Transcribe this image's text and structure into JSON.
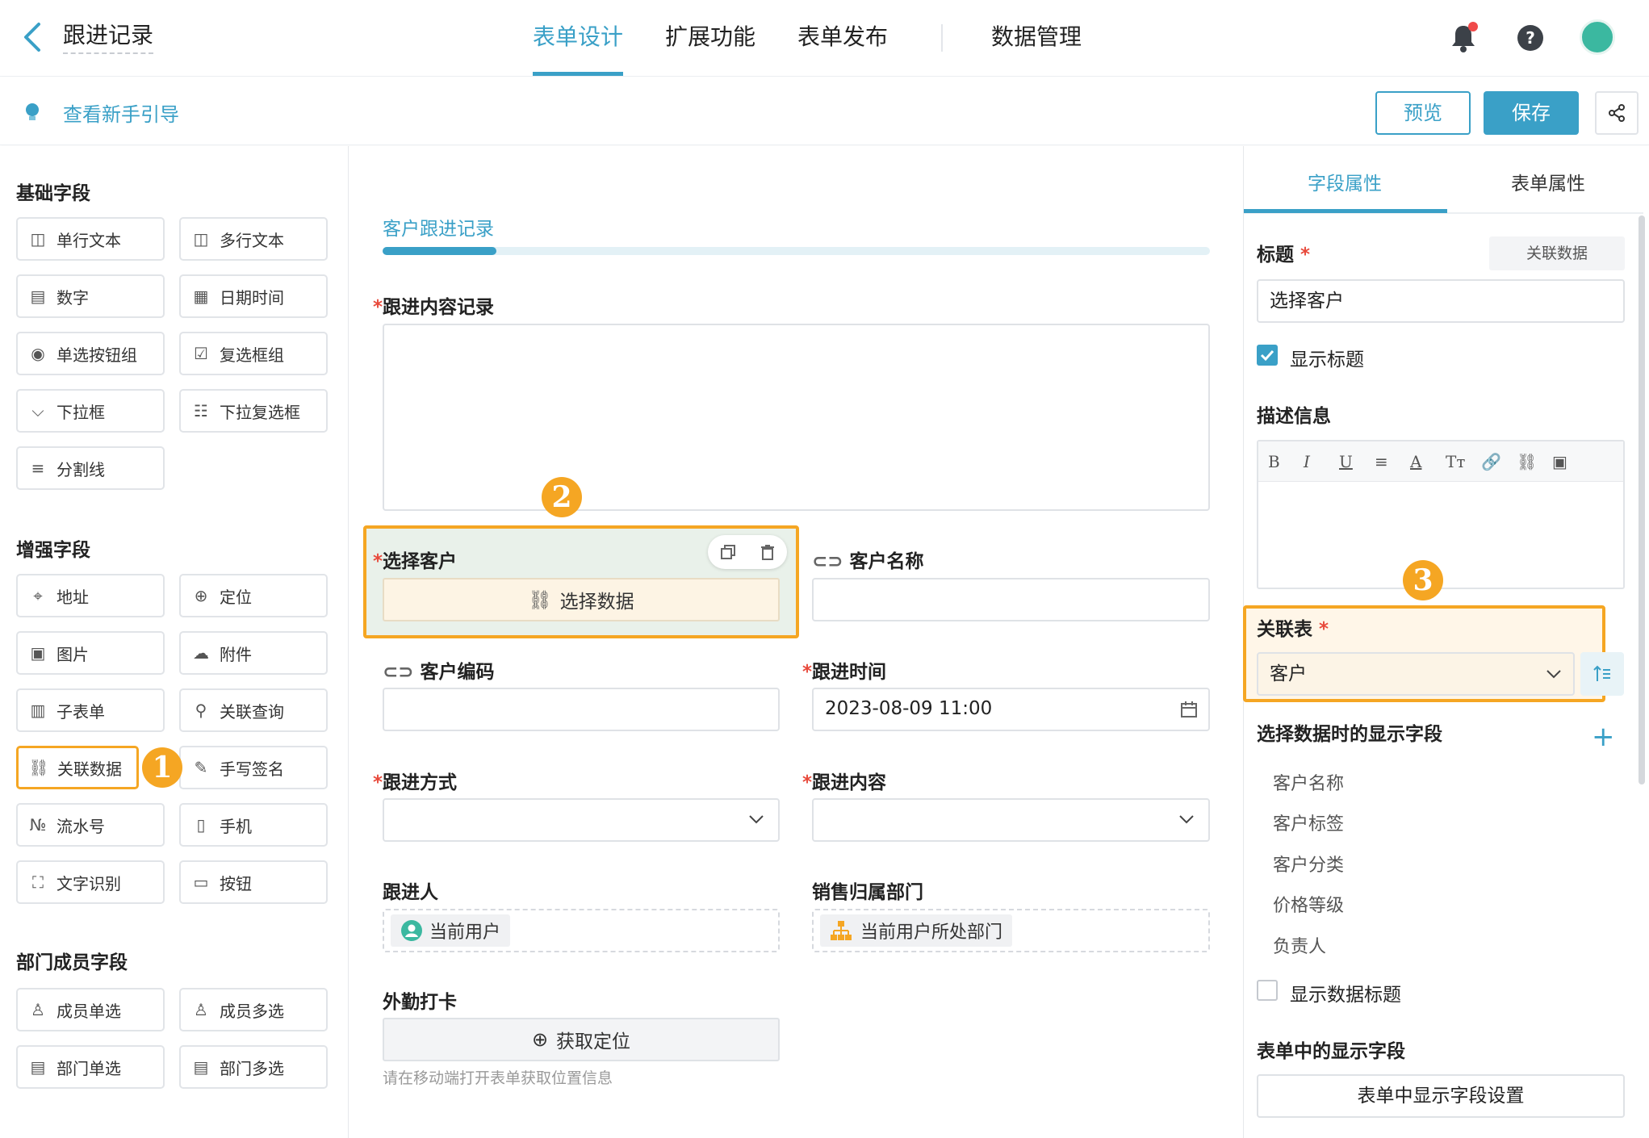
{
  "header": {
    "title": "跟进记录",
    "tabs": [
      "表单设计",
      "扩展功能",
      "表单发布",
      "数据管理"
    ],
    "active_tab": "表单设计"
  },
  "subbar": {
    "guide": "查看新手引导",
    "preview": "预览",
    "save": "保存"
  },
  "left": {
    "basic_title": "基础字段",
    "basic": [
      "单行文本",
      "多行文本",
      "数字",
      "日期时间",
      "单选按钮组",
      "复选框组",
      "下拉框",
      "下拉复选框",
      "分割线"
    ],
    "enhanced_title": "增强字段",
    "enhanced": [
      "地址",
      "定位",
      "图片",
      "附件",
      "子表单",
      "关联查询",
      "关联数据",
      "手写签名",
      "流水号",
      "手机",
      "文字识别",
      "按钮"
    ],
    "dept_title": "部门成员字段",
    "dept": [
      "成员单选",
      "成员多选",
      "部门单选",
      "部门多选"
    ]
  },
  "form": {
    "tab": "客户跟进记录",
    "content_label": "跟进内容记录",
    "select_customer_label": "选择客户",
    "select_data_btn": "选择数据",
    "customer_name_label": "客户名称",
    "customer_code_label": "客户编码",
    "follow_time_label": "跟进时间",
    "follow_time_value": "2023-08-09 11:00",
    "follow_method_label": "跟进方式",
    "follow_content_label": "跟进内容",
    "follower_label": "跟进人",
    "follower_value": "当前用户",
    "dept_label": "销售归属部门",
    "dept_value": "当前用户所处部门",
    "checkin_label": "外勤打卡",
    "get_location_btn": "获取定位",
    "checkin_hint": "请在移动端打开表单获取位置信息"
  },
  "badges": [
    "1",
    "2",
    "3"
  ],
  "right": {
    "tabs": [
      "字段属性",
      "表单属性"
    ],
    "title_label": "标题",
    "related_data_btn": "关联数据",
    "title_value": "选择客户",
    "show_title": "显示标题",
    "desc_label": "描述信息",
    "toolbar": [
      "B",
      "I",
      "U",
      "≡",
      "A",
      "Tт",
      "🔗",
      "⛓",
      "▣"
    ],
    "rel_table_label": "关联表",
    "rel_table_value": "客户",
    "display_fields_label": "选择数据时的显示字段",
    "display_fields": [
      "客户名称",
      "客户标签",
      "客户分类",
      "价格等级",
      "负责人"
    ],
    "show_data_title": "显示数据标题",
    "form_display_label": "表单中的显示字段",
    "form_display_btn": "表单中显示字段设置"
  },
  "colors": {
    "accent": "#3aa0c7",
    "highlight": "#f5a623",
    "required": "#e84a3c"
  }
}
